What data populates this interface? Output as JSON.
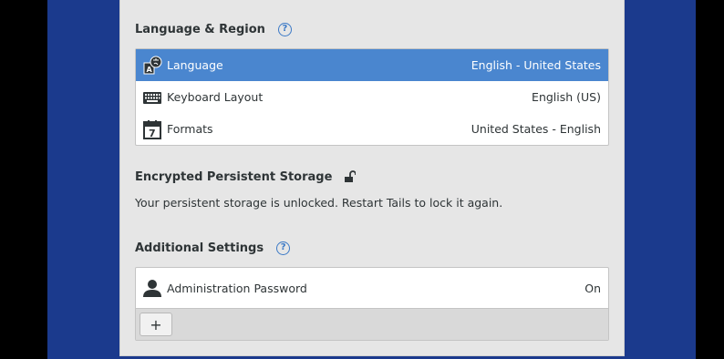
{
  "language_region": {
    "title": "Language & Region",
    "items": [
      {
        "label": "Language",
        "value": "English - United States",
        "icon": "language-icon"
      },
      {
        "label": "Keyboard Layout",
        "value": "English (US)",
        "icon": "keyboard-icon"
      },
      {
        "label": "Formats",
        "value": "United States - English",
        "icon": "calendar-icon"
      }
    ],
    "calendar_day": "7"
  },
  "storage": {
    "title": "Encrypted Persistent Storage",
    "message": "Your persistent storage is unlocked. Restart Tails to lock it again."
  },
  "additional": {
    "title": "Additional Settings",
    "items": [
      {
        "label": "Administration Password",
        "value": "On",
        "icon": "user-icon"
      }
    ],
    "add_label": "+"
  },
  "help_glyph": "?",
  "colors": {
    "desktop": "#1b3a8d",
    "selection": "#4a86cf",
    "help": "#3b79c6"
  }
}
